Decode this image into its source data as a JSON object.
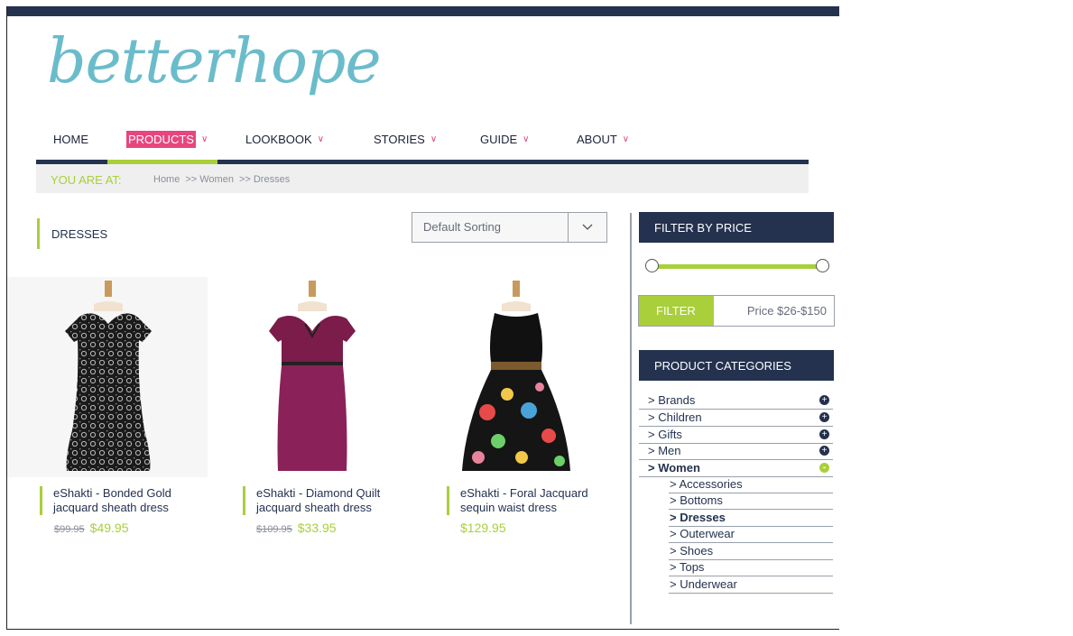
{
  "site": {
    "logo_text": "betterhope"
  },
  "nav": {
    "items": [
      {
        "label": "HOME",
        "has_dropdown": false
      },
      {
        "label": "PRODUCTS",
        "has_dropdown": true,
        "active": true
      },
      {
        "label": "LOOKBOOK",
        "has_dropdown": true
      },
      {
        "label": "STORIES",
        "has_dropdown": true
      },
      {
        "label": "GUIDE",
        "has_dropdown": true
      },
      {
        "label": "ABOUT",
        "has_dropdown": true
      }
    ],
    "chevron": "∨"
  },
  "breadcrumb": {
    "label": "YOU ARE AT:",
    "items": [
      "Home",
      ">> Women",
      ">> Dresses"
    ]
  },
  "listing": {
    "heading": "DRESSES",
    "sort_value": "Default Sorting"
  },
  "products": [
    {
      "title_line1": "eShakti - Bonded Gold",
      "title_line2": "jacquard sheath dress",
      "old_price": "$99.95",
      "price": "$49.95"
    },
    {
      "title_line1": "eShakti - Diamond Quilt",
      "title_line2": "jacquard sheath dress",
      "old_price": "$109.95",
      "price": "$33.95"
    },
    {
      "title_line1": "eShakti - Foral Jacquard",
      "title_line2": "sequin waist dress",
      "old_price": "",
      "price": "$129.95"
    }
  ],
  "filter": {
    "heading": "FILTER BY PRICE",
    "button": "FILTER",
    "range_text": "Price $26-$150"
  },
  "categories": {
    "heading": "PRODUCT CATEGORIES",
    "items": [
      {
        "label": "> Brands",
        "icon": "+"
      },
      {
        "label": "> Children",
        "icon": "+"
      },
      {
        "label": "> Gifts",
        "icon": "+"
      },
      {
        "label": "> Men",
        "icon": "+"
      },
      {
        "label": "> Women",
        "icon": "-"
      }
    ],
    "sub_items": [
      "> Accessories",
      "> Bottoms",
      "> Dresses",
      "> Outerwear",
      "> Shoes",
      "> Tops",
      "> Underwear"
    ]
  },
  "colors": {
    "navy": "#24324f",
    "lime": "#a9cf3b",
    "pink": "#e8457f",
    "logo": "#6bbccb"
  }
}
